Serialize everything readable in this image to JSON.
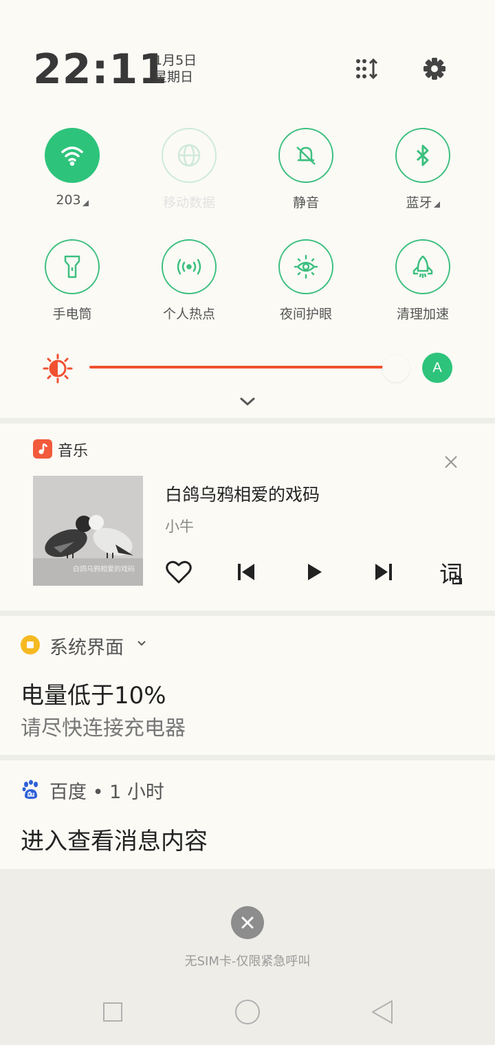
{
  "status": {
    "time": "22:11",
    "date": "1月5日",
    "weekday": "星期日"
  },
  "header_icons": [
    "edit-tiles-icon",
    "settings-gear-icon"
  ],
  "toggles": [
    {
      "label": "203",
      "icon": "wifi-icon",
      "state": "on",
      "has_more": true
    },
    {
      "label": "移动数据",
      "icon": "globe-icon",
      "state": "disabled",
      "has_more": false
    },
    {
      "label": "静音",
      "icon": "bell-muted-icon",
      "state": "off",
      "has_more": false
    },
    {
      "label": "蓝牙",
      "icon": "bluetooth-icon",
      "state": "off",
      "has_more": true
    },
    {
      "label": "手电筒",
      "icon": "flashlight-icon",
      "state": "off",
      "has_more": false
    },
    {
      "label": "个人热点",
      "icon": "hotspot-icon",
      "state": "off",
      "has_more": false
    },
    {
      "label": "夜间护眼",
      "icon": "eye-protect-icon",
      "state": "off",
      "has_more": false
    },
    {
      "label": "清理加速",
      "icon": "rocket-clean-icon",
      "state": "off",
      "has_more": false
    }
  ],
  "brightness": {
    "level": 0.98,
    "auto_label": "A"
  },
  "colors": {
    "accent": "#2ec37b",
    "brightness": "#f0502f",
    "music_app": "#f25a3c",
    "system_app": "#f5b921"
  },
  "music": {
    "app_name": "音乐",
    "song_title": "白鸽乌鸦相爱的戏码",
    "artist": "小牛",
    "art_caption": "白鸽乌鸦相爱的戏码",
    "controls": [
      "heart-icon",
      "previous-icon",
      "play-icon",
      "next-icon",
      "lyrics-icon"
    ],
    "lyrics_glyph": "词"
  },
  "notifications": [
    {
      "app": "系统界面",
      "title": "电量低于10%",
      "body": "请尽快连接充电器"
    },
    {
      "app": "百度 • 1 小时",
      "title": "进入查看消息内容"
    }
  ],
  "footer": {
    "sim_text": "无SIM卡-仅限紧急呼叫"
  }
}
